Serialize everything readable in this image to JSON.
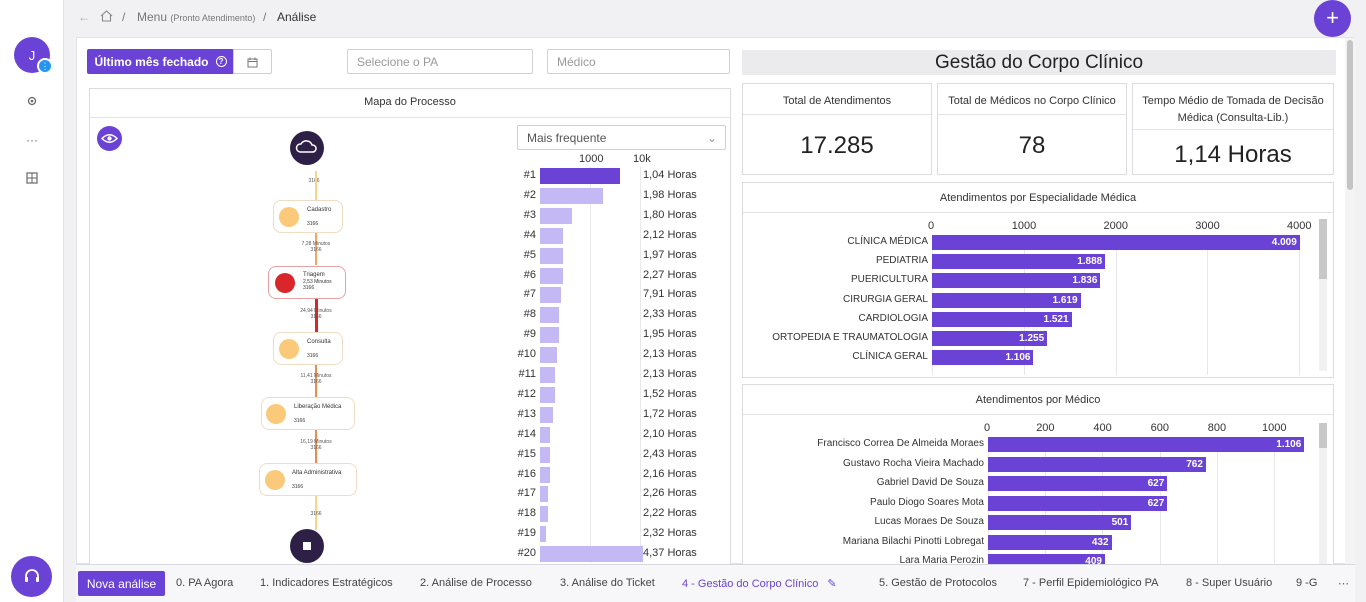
{
  "user": {
    "initial": "J",
    "badge": "⋮"
  },
  "breadcrumb": {
    "menu": "Menu",
    "menu_sub": "(Pronto Atendimento)",
    "current": "Análise"
  },
  "filters": {
    "period_button": "Último mês fechado",
    "pa_placeholder": "Selecione o PA",
    "doctor_placeholder": "Médico"
  },
  "dashboard_title": "Gestão do Corpo Clínico",
  "process_map": {
    "title": "Mapa do Processo",
    "sort_select": "Mais frequente",
    "axis_ticks": [
      "1000",
      "10k"
    ],
    "start_count": "3166",
    "end_count": "3166",
    "nodes": [
      {
        "label": "Cadastro",
        "count": "3166"
      },
      {
        "label": "Triagem",
        "time": "2,53 Minutos",
        "count": "3166"
      },
      {
        "label": "Consulta",
        "count": "3166"
      },
      {
        "label": "Liberação Médica",
        "count": "3166"
      },
      {
        "label": "Alta Administrativa",
        "count": "3166"
      }
    ],
    "edges": [
      {
        "time": "7,28 Minutos",
        "count": "3166"
      },
      {
        "time": "24,94 Minutos",
        "count": "3166"
      },
      {
        "time": "11,41 Minutos",
        "count": "3166"
      },
      {
        "time": "16,19 Minutos",
        "count": "3166"
      }
    ],
    "variants": [
      {
        "rank": "#1",
        "duration": "1,04 Horas",
        "frac": 0.42
      },
      {
        "rank": "#2",
        "duration": "1,98 Horas",
        "frac": 0.33
      },
      {
        "rank": "#3",
        "duration": "1,80 Horas",
        "frac": 0.17
      },
      {
        "rank": "#4",
        "duration": "2,12 Horas",
        "frac": 0.12
      },
      {
        "rank": "#5",
        "duration": "1,97 Horas",
        "frac": 0.12
      },
      {
        "rank": "#6",
        "duration": "2,27 Horas",
        "frac": 0.12
      },
      {
        "rank": "#7",
        "duration": "7,91 Horas",
        "frac": 0.11
      },
      {
        "rank": "#8",
        "duration": "2,33 Horas",
        "frac": 0.1
      },
      {
        "rank": "#9",
        "duration": "1,95 Horas",
        "frac": 0.1
      },
      {
        "rank": "#10",
        "duration": "2,13 Horas",
        "frac": 0.09
      },
      {
        "rank": "#11",
        "duration": "2,13 Horas",
        "frac": 0.08
      },
      {
        "rank": "#12",
        "duration": "1,52 Horas",
        "frac": 0.08
      },
      {
        "rank": "#13",
        "duration": "1,72 Horas",
        "frac": 0.07
      },
      {
        "rank": "#14",
        "duration": "2,10 Horas",
        "frac": 0.05
      },
      {
        "rank": "#15",
        "duration": "2,43 Horas",
        "frac": 0.05
      },
      {
        "rank": "#16",
        "duration": "2,16 Horas",
        "frac": 0.05
      },
      {
        "rank": "#17",
        "duration": "2,26 Horas",
        "frac": 0.04
      },
      {
        "rank": "#18",
        "duration": "2,22 Horas",
        "frac": 0.04
      },
      {
        "rank": "#19",
        "duration": "2,32 Horas",
        "frac": 0.03
      },
      {
        "rank": "#20",
        "duration": "4,37 Horas",
        "frac": 0.54
      }
    ]
  },
  "kpis": [
    {
      "title": "Total de Atendimentos",
      "value": "17.285"
    },
    {
      "title": "Total de Médicos no Corpo Clínico",
      "value": "78"
    },
    {
      "title": "Tempo Médio de Tomada de Decisão Médica (Consulta-Lib.)",
      "value": "1,14 Horas"
    }
  ],
  "chart_data": [
    {
      "type": "bar",
      "title": "Atendimentos por Especialidade Médica",
      "ticks": [
        "0",
        "1000",
        "2000",
        "3000",
        "4000"
      ],
      "xlim": [
        0,
        4000
      ],
      "categories": [
        "CLÍNICA MÉDICA",
        "PEDIATRIA",
        "PUERICULTURA",
        "CIRURGIA GERAL",
        "CARDIOLOGIA",
        "ORTOPEDIA E TRAUMATOLOGIA",
        "CLÍNICA GERAL"
      ],
      "values": [
        4009,
        1888,
        1836,
        1619,
        1521,
        1255,
        1106
      ],
      "value_labels": [
        "4.009",
        "1.888",
        "1.836",
        "1.619",
        "1.521",
        "1.255",
        "1.106"
      ]
    },
    {
      "type": "bar",
      "title": "Atendimentos por Médico",
      "ticks": [
        "0",
        "200",
        "400",
        "600",
        "800",
        "1000"
      ],
      "xlim": [
        0,
        1000
      ],
      "categories": [
        "Francisco Correa De Almeida Moraes",
        "Gustavo Rocha Vieira Machado",
        "Gabriel David De Souza",
        "Paulo Diogo Soares Mota",
        "Lucas Moraes De Souza",
        "Mariana Bilachi Pinotti Lobregat",
        "Lara Maria Perozin"
      ],
      "values": [
        1106,
        762,
        627,
        627,
        501,
        432,
        409
      ],
      "value_labels": [
        "1.106",
        "762",
        "627",
        "627",
        "501",
        "432",
        "409"
      ]
    }
  ],
  "tabs": {
    "new_analysis": "Nova análise",
    "items": [
      "0. PA Agora",
      "1. Indicadores Estratégicos",
      "2. Análise de Processo",
      "3. Análise do Ticket",
      "4 - Gestão do Corpo Clínico",
      "5. Gestão de Protocolos",
      "7 - Perfil Epidemiológico PA",
      "8 - Super Usuário",
      "9 -G"
    ],
    "active_index": 4,
    "more": "⋯"
  },
  "colors": {
    "accent": "#6a43d6",
    "variant_bar": "#c4b8f5",
    "red_node": "#d9262b",
    "orange_node": "#fbc97a"
  }
}
